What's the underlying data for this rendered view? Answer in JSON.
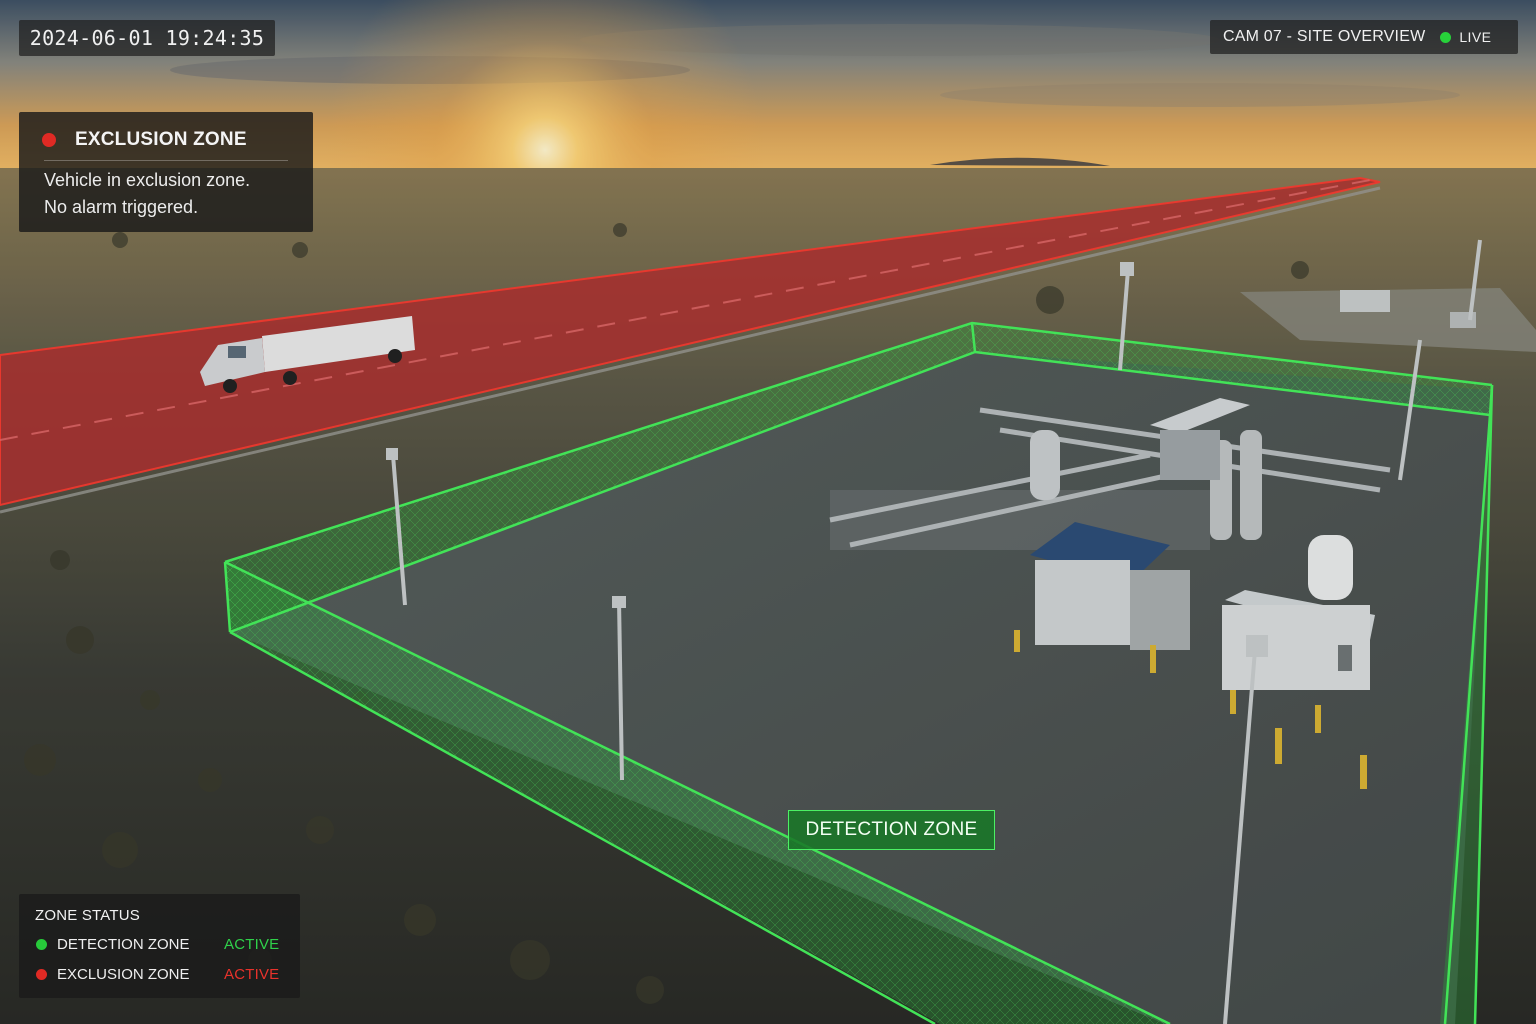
{
  "timestamp": "2024-06-01 19:24:35",
  "camera": {
    "title": "CAM 07 - SITE OVERVIEW",
    "live_label": "LIVE",
    "live_color": "#27d13a"
  },
  "alert": {
    "title": "EXCLUSION ZONE",
    "message_line1": "Vehicle in exclusion zone.",
    "message_line2": "No alarm triggered.",
    "color": "#e02a24"
  },
  "detection_zone_label": "DETECTION ZONE",
  "zone_status": {
    "title": "ZONE STATUS",
    "zones": [
      {
        "name": "DETECTION ZONE",
        "state": "ACTIVE",
        "dot_color": "#27c93a",
        "state_color": "#2fd14a"
      },
      {
        "name": "EXCLUSION ZONE",
        "state": "ACTIVE",
        "dot_color": "#e02a24",
        "state_color": "#e8322b"
      }
    ]
  }
}
